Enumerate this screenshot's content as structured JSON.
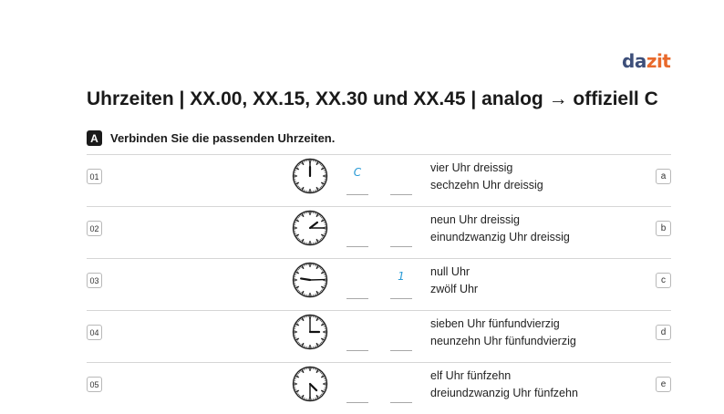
{
  "logo": {
    "part1": "da",
    "part2": "zit"
  },
  "title": "Uhrzeiten | XX.00, XX.15, XX.30 und XX.45 | analog → offiziell C",
  "instruction": {
    "badge": "A",
    "text": "Verbinden Sie die passenden Uhrzeiten."
  },
  "rows": [
    {
      "num": "01",
      "clock": {
        "hour": 12,
        "minute": 0
      },
      "answer_left": "C",
      "answer_right": "",
      "line1": "vier Uhr dreissig",
      "line2": "sechzehn Uhr dreissig",
      "letter": "a"
    },
    {
      "num": "02",
      "clock": {
        "hour": 1.75,
        "minute": 15
      },
      "answer_left": "",
      "answer_right": "",
      "line1": "neun Uhr dreissig",
      "line2": "einundzwanzig Uhr dreissig",
      "letter": "b"
    },
    {
      "num": "03",
      "clock": {
        "hour": 9.3,
        "minute": 14.7
      },
      "answer_left": "",
      "answer_right": "1",
      "line1": "null Uhr",
      "line2": "zwölf Uhr",
      "letter": "c"
    },
    {
      "num": "04",
      "clock": {
        "hour": 3,
        "minute": 0
      },
      "answer_left": "",
      "answer_right": "",
      "line1": "sieben Uhr fünfundvierzig",
      "line2": "neunzehn Uhr fünfundvierzig",
      "letter": "d"
    },
    {
      "num": "05",
      "clock": {
        "hour": 4.5,
        "minute": 30
      },
      "answer_left": "",
      "answer_right": "",
      "line1": "elf Uhr fünfzehn",
      "line2": "dreiundzwanzig Uhr fünfzehn",
      "letter": "e"
    }
  ]
}
